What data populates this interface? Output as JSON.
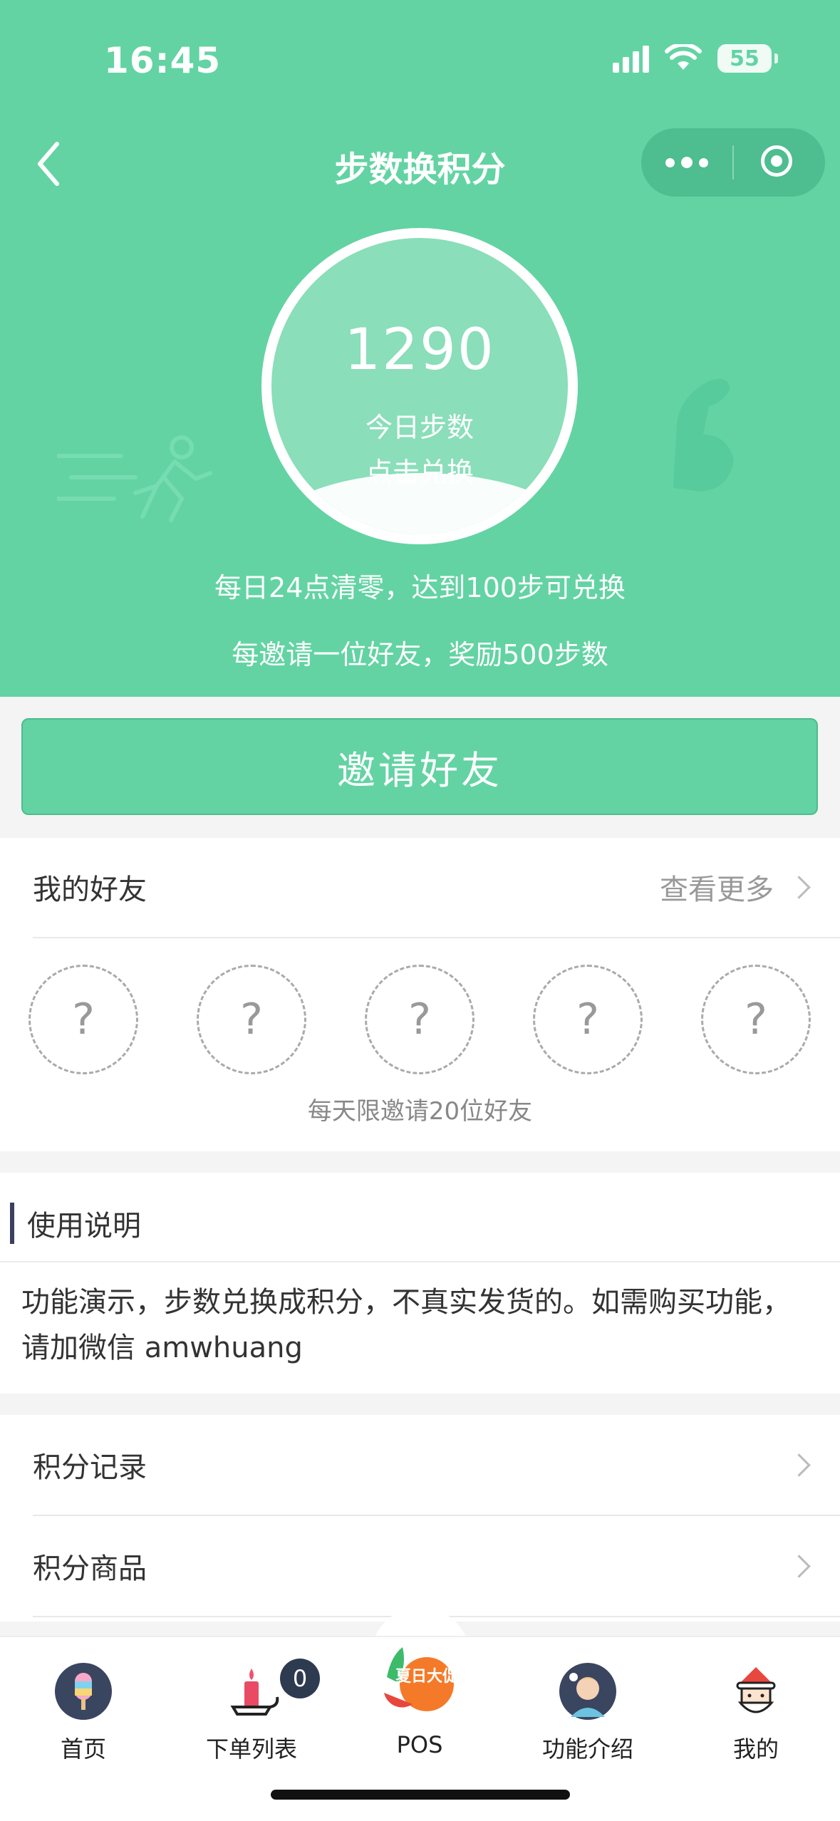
{
  "status_bar": {
    "time": "16:45",
    "battery": "55"
  },
  "nav": {
    "title": "步数换积分"
  },
  "hero": {
    "step_count": "1290",
    "step_label": "今日步数",
    "step_action": "点击兑换",
    "rule_reset": "每日24点清零，达到100步可兑换",
    "rule_invite": "每邀请一位好友，奖励500步数"
  },
  "invite_button": {
    "label": "邀请好友"
  },
  "friends": {
    "title": "我的好友",
    "view_more": "查看更多",
    "slots": [
      "?",
      "?",
      "?",
      "?",
      "?"
    ],
    "note": "每天限邀请20位好友"
  },
  "usage": {
    "title": "使用说明",
    "text": "功能演示，步数兑换成积分，不真实发货的。如需购买功能，请加微信 amwhuang"
  },
  "menu": {
    "items": [
      {
        "label": "积分记录"
      },
      {
        "label": "积分商品"
      }
    ]
  },
  "tabbar": {
    "tabs": [
      {
        "label": "首页",
        "icon": "popsicle-icon"
      },
      {
        "label": "下单列表",
        "icon": "candle-icon",
        "badge": "0"
      },
      {
        "label": "POS",
        "icon": "summer-sale-icon",
        "icon_text": "夏日大促"
      },
      {
        "label": "功能介绍",
        "icon": "avatar-idea-icon"
      },
      {
        "label": "我的",
        "icon": "santa-icon"
      }
    ]
  },
  "colors": {
    "brand_green": "#63d3a3",
    "text_primary": "#333333",
    "text_secondary": "#999999"
  }
}
